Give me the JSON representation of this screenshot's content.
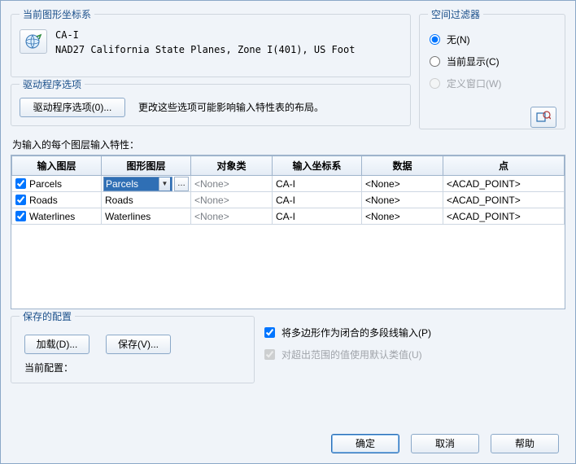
{
  "coord": {
    "legend": "当前图形坐标系",
    "name": "CA-I",
    "desc": "NAD27 California State Planes, Zone I(401), US Foot"
  },
  "filter": {
    "legend": "空间过滤器",
    "opt_none": "无(N)",
    "opt_current": "当前显示(C)",
    "opt_define": "定义窗口(W)"
  },
  "driver": {
    "legend": "驱动程序选项",
    "btn": "驱动程序选项(0)...",
    "hint": "更改这些选项可能影响输入特性表的布局。"
  },
  "table": {
    "label": "为输入的每个图层输入特性：",
    "headers": [
      "输入图层",
      "图形图层",
      "对象类",
      "输入坐标系",
      "数据",
      "点"
    ],
    "rows": [
      {
        "checked": true,
        "input_layer": "Parcels",
        "draw_layer": "Parcels",
        "editing": true,
        "obj_class": "<None>",
        "coord": "CA-I",
        "data": "<None>",
        "point": "<ACAD_POINT>"
      },
      {
        "checked": true,
        "input_layer": "Roads",
        "draw_layer": "Roads",
        "editing": false,
        "obj_class": "<None>",
        "coord": "CA-I",
        "data": "<None>",
        "point": "<ACAD_POINT>"
      },
      {
        "checked": true,
        "input_layer": "Waterlines",
        "draw_layer": "Waterlines",
        "editing": false,
        "obj_class": "<None>",
        "coord": "CA-I",
        "data": "<None>",
        "point": "<ACAD_POINT>"
      }
    ]
  },
  "saved": {
    "legend": "保存的配置",
    "load_btn": "加载(D)...",
    "save_btn": "保存(V)...",
    "current_label": "当前配置：",
    "opt_closed_poly": "将多边形作为闭合的多段线输入(P)",
    "opt_default_class": "对超出范围的值使用默认类值(U)"
  },
  "buttons": {
    "ok": "确定",
    "cancel": "取消",
    "help": "帮助"
  }
}
